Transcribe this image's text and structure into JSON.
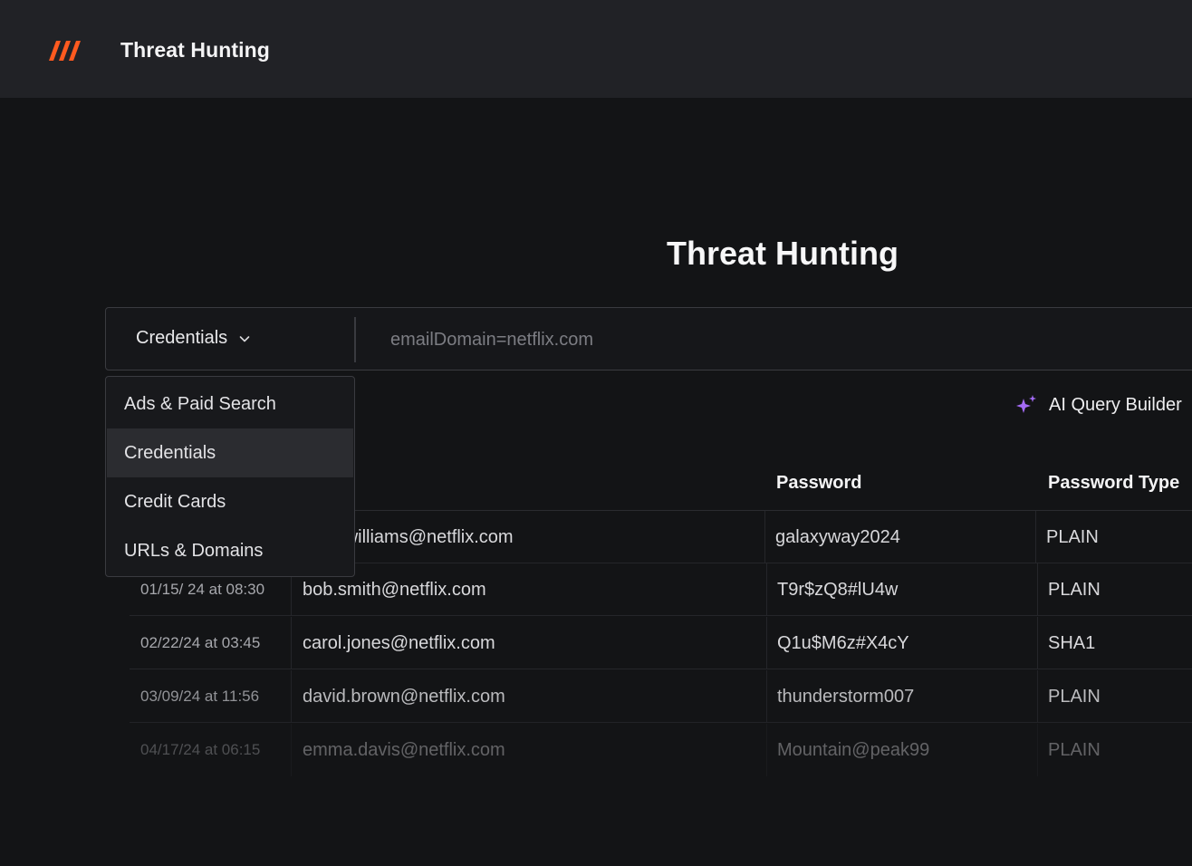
{
  "app": {
    "title": "Threat Hunting"
  },
  "page": {
    "title": "Threat Hunting"
  },
  "search": {
    "category": "Credentials",
    "query_placeholder": "emailDomain=netflix.com"
  },
  "dropdown": {
    "items": [
      {
        "label": "Ads & Paid Search",
        "selected": false
      },
      {
        "label": "Credentials",
        "selected": true
      },
      {
        "label": "Credit Cards",
        "selected": false
      },
      {
        "label": "URLs & Domains",
        "selected": false
      }
    ]
  },
  "ai_builder": {
    "label": "AI Query Builder"
  },
  "table": {
    "columns": [
      "Password",
      "Password Type"
    ],
    "rows": [
      {
        "date": "",
        "email": "alice.williams@netflix.com",
        "password": "galaxyway2024",
        "type": "PLAIN"
      },
      {
        "date": "01/15/ 24 at 08:30",
        "email": "bob.smith@netflix.com",
        "password": "T9r$zQ8#lU4w",
        "type": "PLAIN"
      },
      {
        "date": "02/22/24 at 03:45",
        "email": "carol.jones@netflix.com",
        "password": "Q1u$M6z#X4cY",
        "type": "SHA1"
      },
      {
        "date": "03/09/24 at 11:56",
        "email": "david.brown@netflix.com",
        "password": "thunderstorm007",
        "type": "PLAIN"
      },
      {
        "date": "04/17/24 at 06:15",
        "email": "emma.davis@netflix.com",
        "password": "Mountain@peak99",
        "type": "PLAIN"
      }
    ]
  },
  "colors": {
    "logo_accent": "#ff5a1f",
    "sparkle_accent": "#a36bf5"
  }
}
